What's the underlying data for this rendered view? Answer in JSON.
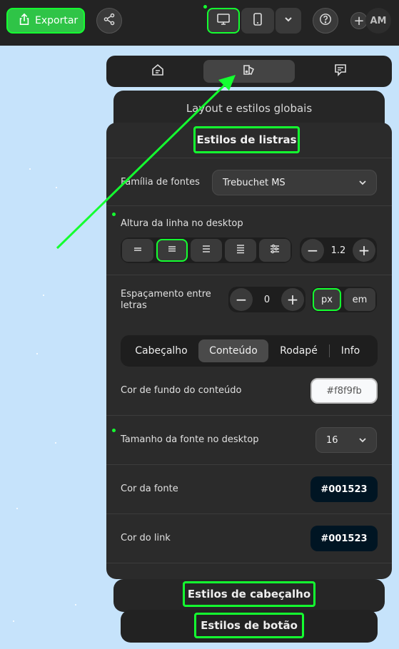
{
  "topbar": {
    "export_label": "Exportar",
    "avatar_initials": "AM",
    "add_symbol": "+"
  },
  "panel": {
    "section_back_title": "Layout e estilos globais",
    "section_title": "Estilos de listras",
    "font_family_label": "Família de fontes",
    "font_family_value": "Trebuchet MS",
    "line_height_label": "Altura da linha no desktop",
    "line_height_value": "1.2",
    "letter_spacing_label": "Espaçamento entre letras",
    "letter_spacing_value": "0",
    "unit_px": "px",
    "unit_em": "em",
    "tabs": [
      "Cabeçalho",
      "Conteúdo",
      "Rodapé",
      "Info"
    ],
    "bg_color_label": "Cor de fundo do conteúdo",
    "bg_color_value": "#f8f9fb",
    "font_size_label": "Tamanho da fonte no desktop",
    "font_size_value": "16",
    "font_color_label": "Cor da fonte",
    "font_color_value": "#001523",
    "link_color_label": "Cor do link",
    "link_color_value": "#001523",
    "minus": "−",
    "plus": "+"
  },
  "bottom": {
    "header_styles": "Estilos de cabeçalho",
    "button_styles": "Estilos de botão"
  },
  "colors": {
    "accent": "#14ff30",
    "export_green": "#2fc447",
    "canvas_bg": "#c6e3fb",
    "panel_bg": "#2b2b2b"
  }
}
